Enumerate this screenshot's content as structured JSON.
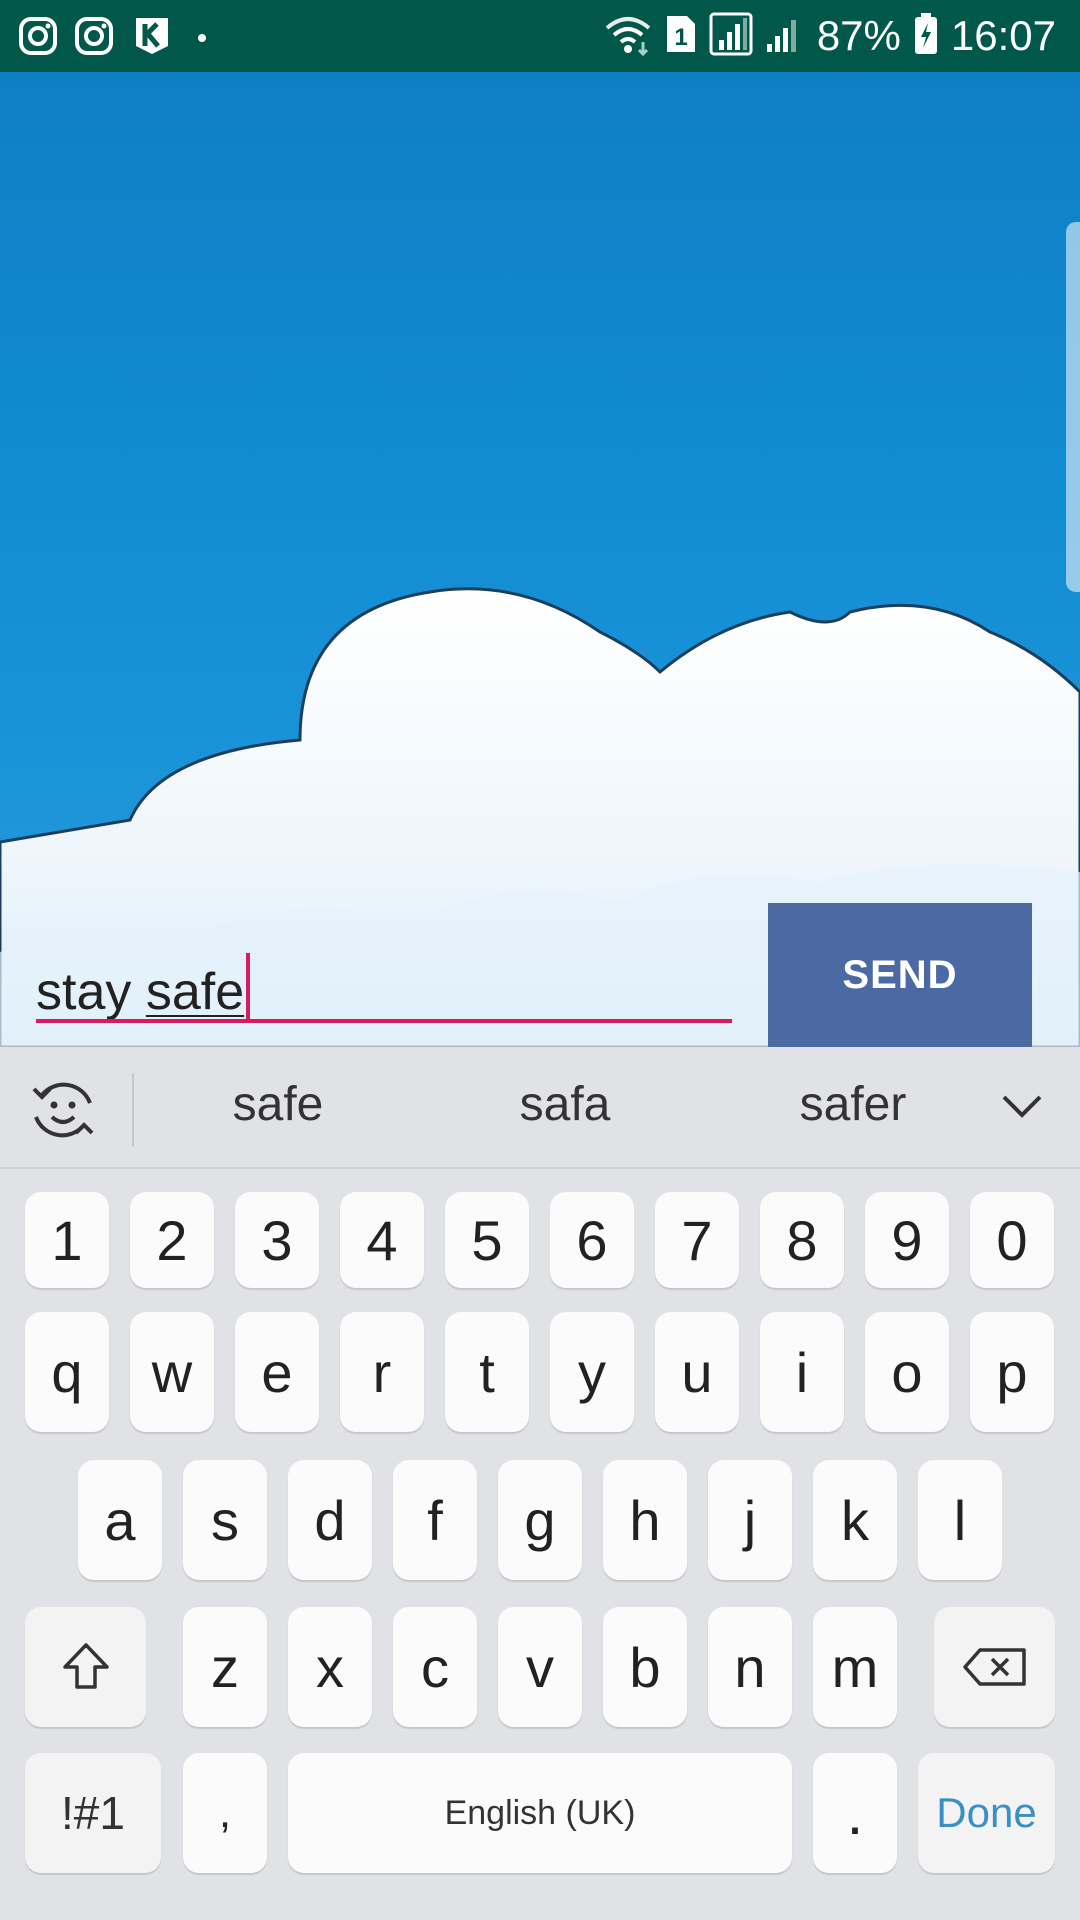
{
  "status_bar": {
    "left_icons": [
      "instagram-icon",
      "instagram-icon",
      "kik-icon",
      "dot-icon"
    ],
    "right_icons": [
      "wifi-icon",
      "sim-1-icon",
      "signal-icon",
      "signal-icon",
      "battery-charging-icon"
    ],
    "sim_label": "1",
    "battery": "87%",
    "time": "16:07"
  },
  "compose": {
    "text_before": "stay ",
    "text_underlined": "safe",
    "send_label": "SEND"
  },
  "keyboard": {
    "suggestions": [
      "safe",
      "safa",
      "safer"
    ],
    "number_row": [
      "1",
      "2",
      "3",
      "4",
      "5",
      "6",
      "7",
      "8",
      "9",
      "0"
    ],
    "row1": [
      "q",
      "w",
      "e",
      "r",
      "t",
      "y",
      "u",
      "i",
      "o",
      "p"
    ],
    "row2": [
      "a",
      "s",
      "d",
      "f",
      "g",
      "h",
      "j",
      "k",
      "l"
    ],
    "row3": [
      "z",
      "x",
      "c",
      "v",
      "b",
      "n",
      "m"
    ],
    "symbols_label": "!#1",
    "comma_label": ",",
    "space_label": "English (UK)",
    "period_label": ".",
    "done_label": "Done"
  },
  "colors": {
    "status_bar": "#01574a",
    "accent": "#d81b60",
    "send_button": "#4b6aa4",
    "done_text": "#3a8fc4",
    "keyboard_bg": "#e1e2e5"
  }
}
